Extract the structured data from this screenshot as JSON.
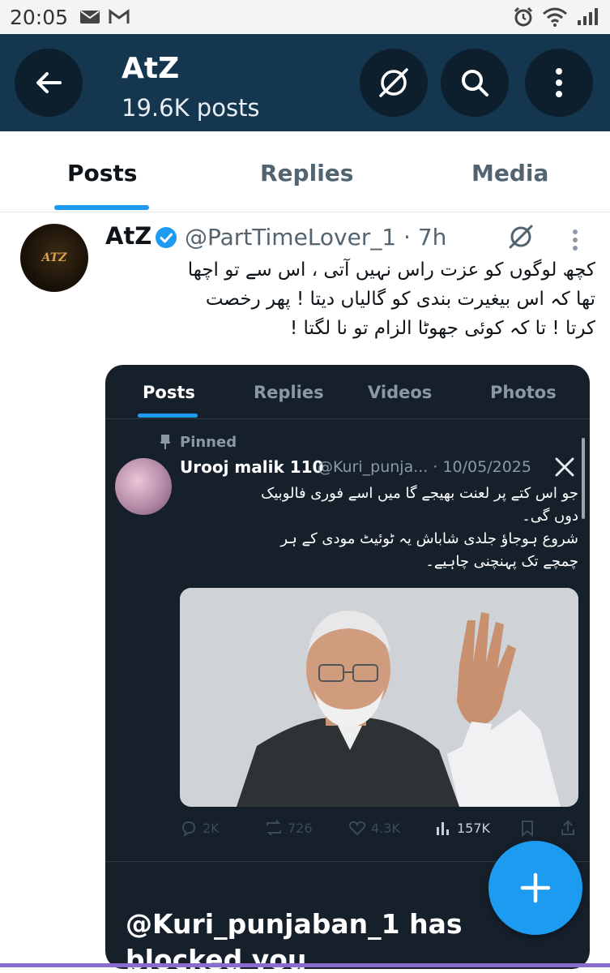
{
  "status_bar": {
    "time": "20:05",
    "icons": [
      "mail-icon",
      "gmail-icon",
      "alarm-icon",
      "wifi-icon",
      "signal-icon"
    ]
  },
  "header": {
    "title": "AtZ",
    "subtitle": "19.6K posts",
    "icons": [
      "back-arrow-icon",
      "grok-icon",
      "search-icon",
      "more-vert-icon"
    ]
  },
  "tabs": [
    {
      "label": "Posts",
      "active": true
    },
    {
      "label": "Replies",
      "active": false
    },
    {
      "label": "Media",
      "active": false
    }
  ],
  "post": {
    "author_name": "AtZ",
    "handle_time": "@PartTimeLover_1 · 7h",
    "text_lines": [
      "کچھ لوگوں کو عزت راس نہیں آتی ، اس سے تو اچھا",
      "تھا کہ اس بیغیرت بندی کو گالیاں دیتا ! پھر رخصت",
      "کرتا ! تا کہ کوئی جھوٹا الزام تو نا لگتا !"
    ],
    "avatar_text": "ATZ"
  },
  "embedded": {
    "tabs": [
      "Posts",
      "Replies",
      "Videos",
      "Photos"
    ],
    "pinned_label": "Pinned",
    "name": "Urooj malik 110",
    "handle_date": "@Kuri_punja... · 10/05/2025",
    "text_lines": [
      "جو اس کتے پر لعنت بھیجے گا میں اسے فوری فالوبیک",
      "دوں گی۔",
      "شروع ہوجاؤ جلدی شاباش یہ ٹوئیٹ مودی کے ہر",
      "چمچے تک پہنچنی چاہیے۔"
    ],
    "actions": {
      "replies": "2K",
      "reposts": "726",
      "likes": "4.3K",
      "views": "157K"
    },
    "blocked_lines": [
      "@Kuri_punjaban_1 has",
      "blocked you"
    ]
  },
  "colors": {
    "header_bg": "#14364f",
    "accent": "#1d9bf0",
    "embed_bg": "#15202b"
  }
}
